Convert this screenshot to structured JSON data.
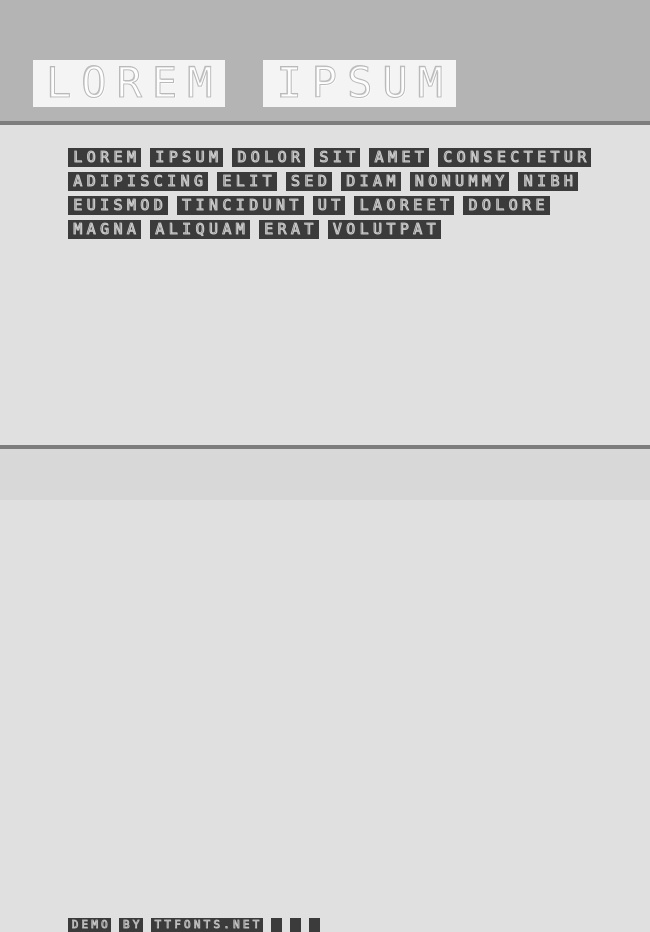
{
  "page": {
    "background_color": "#e0e0e0",
    "header_band_color": "#b4b4b4",
    "rule_color": "#7d7d7d",
    "footer_band_color": "#d8d8d8",
    "chip_bg_color": "#f4f4f4",
    "word_bg_color": "#3b3b3b",
    "glyph_stroke_color": "#cfcfcf"
  },
  "header": {
    "title_words": [
      "LOREM",
      "IPSUM"
    ]
  },
  "specimen": {
    "lines": [
      [
        "LOREM",
        "IPSUM",
        "DOLOR",
        "SIT",
        "AMET",
        "CONSECTETUR"
      ],
      [
        "ADIPISCING",
        "ELIT",
        "SED",
        "DIAM",
        "NONUMMY",
        "NIBH"
      ],
      [
        "EUISMOD",
        "TINCIDUNT",
        "UT",
        "LAOREET",
        "DOLORE"
      ],
      [
        "MAGNA",
        "ALIQUAM",
        "ERAT",
        "VOLUTPAT"
      ]
    ]
  },
  "footer": {
    "words": [
      "DEMO",
      "BY",
      "TTFONTS.NET"
    ],
    "trailing_blanks": 3
  }
}
